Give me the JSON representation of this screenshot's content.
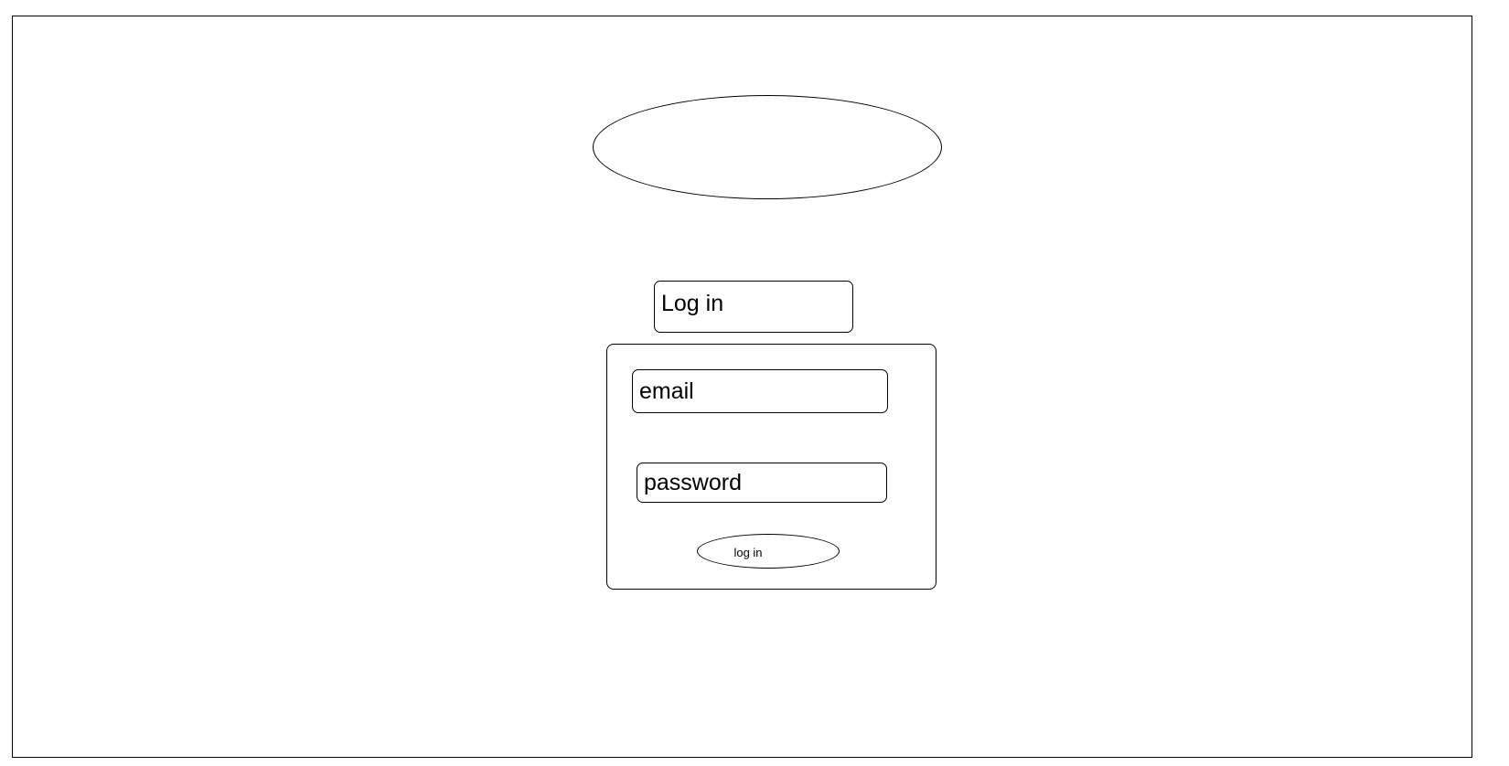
{
  "header": {
    "title": "Log in"
  },
  "login_form": {
    "email": {
      "value": "",
      "placeholder": "email"
    },
    "password": {
      "value": "",
      "placeholder": "password"
    },
    "submit_label": "log in"
  },
  "colors": {
    "border": "#000000",
    "background": "#ffffff",
    "text": "#000000"
  }
}
